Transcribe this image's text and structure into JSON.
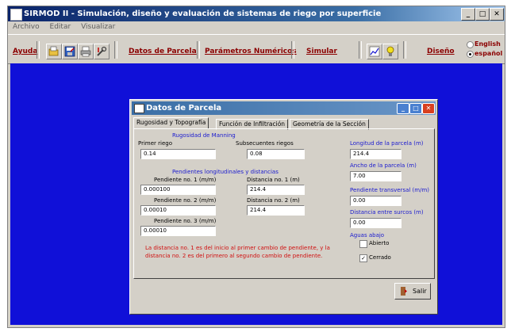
{
  "window": {
    "title": "SIRMOD II - Simulación, diseño y evaluación de sistemas de riego por superficie",
    "min_glyph": "_",
    "max_glyph": "□",
    "close_glyph": "✕"
  },
  "menu": [
    "Archivo",
    "Editar",
    "Visualizar"
  ],
  "toolbar": {
    "ayuda": "Ayuda",
    "datos_parcela": "Datos de Parcela",
    "parametros_numericos": "Parámetros Numéricos",
    "simular": "Simular",
    "diseno": "Diseño",
    "lang_english": "English",
    "lang_espanol": "español"
  },
  "dialog": {
    "title": "Datos de Parcela",
    "tabs": [
      "Rugosidad y Topografía",
      "Función de Infiltración",
      "Geometría de la Sección"
    ],
    "manning_heading": "Rugosidad de Manning",
    "primer_riego_label": "Primer riego",
    "primer_riego_value": "0.14",
    "subsecuentes_label": "Subsecuentes riegos",
    "subsecuentes_value": "0.08",
    "pendientes_heading": "Pendientes longitudinales y distancias",
    "pendiente1_label": "Pendiente no. 1 (m/m)",
    "pendiente1_value": "0.000100",
    "distancia1_label": "Distancia no. 1 (m)",
    "distancia1_value": "214.4",
    "pendiente2_label": "Pendiente no. 2 (m/m)",
    "pendiente2_value": "0.00010",
    "distancia2_label": "Distancia no. 2 (m)",
    "distancia2_value": "214.4",
    "pendiente3_label": "Pendiente no. 3 (m/m)",
    "pendiente3_value": "0.00010",
    "longitud_label": "Longitud de la parcela (m)",
    "longitud_value": "214.4",
    "ancho_label": "Ancho de la parcela (m)",
    "ancho_value": "7.00",
    "pendiente_transversal_label": "Pendiente transversal (m/m)",
    "pendiente_transversal_value": "0.00",
    "distancia_surcos_label": "Distancia entre surcos (m)",
    "distancia_surcos_value": "0.00",
    "aguas_abajo_label": "Aguas abajo",
    "abierto_label": "Abierto",
    "cerrado_label": "Cerrado",
    "note_line1": "La distancia no. 1 es del inicio al primer cambio de pendiente, y la",
    "note_line2": "distancia no. 2 es del primero al segundo cambio de pendiente.",
    "exit_label": "Salir"
  },
  "colors": {
    "workspace": "#1010d8",
    "title_gradient_start": "#0a246a",
    "link_color": "#8b0000",
    "heading_blue": "#1a1ad0",
    "note_red": "#d01010"
  }
}
